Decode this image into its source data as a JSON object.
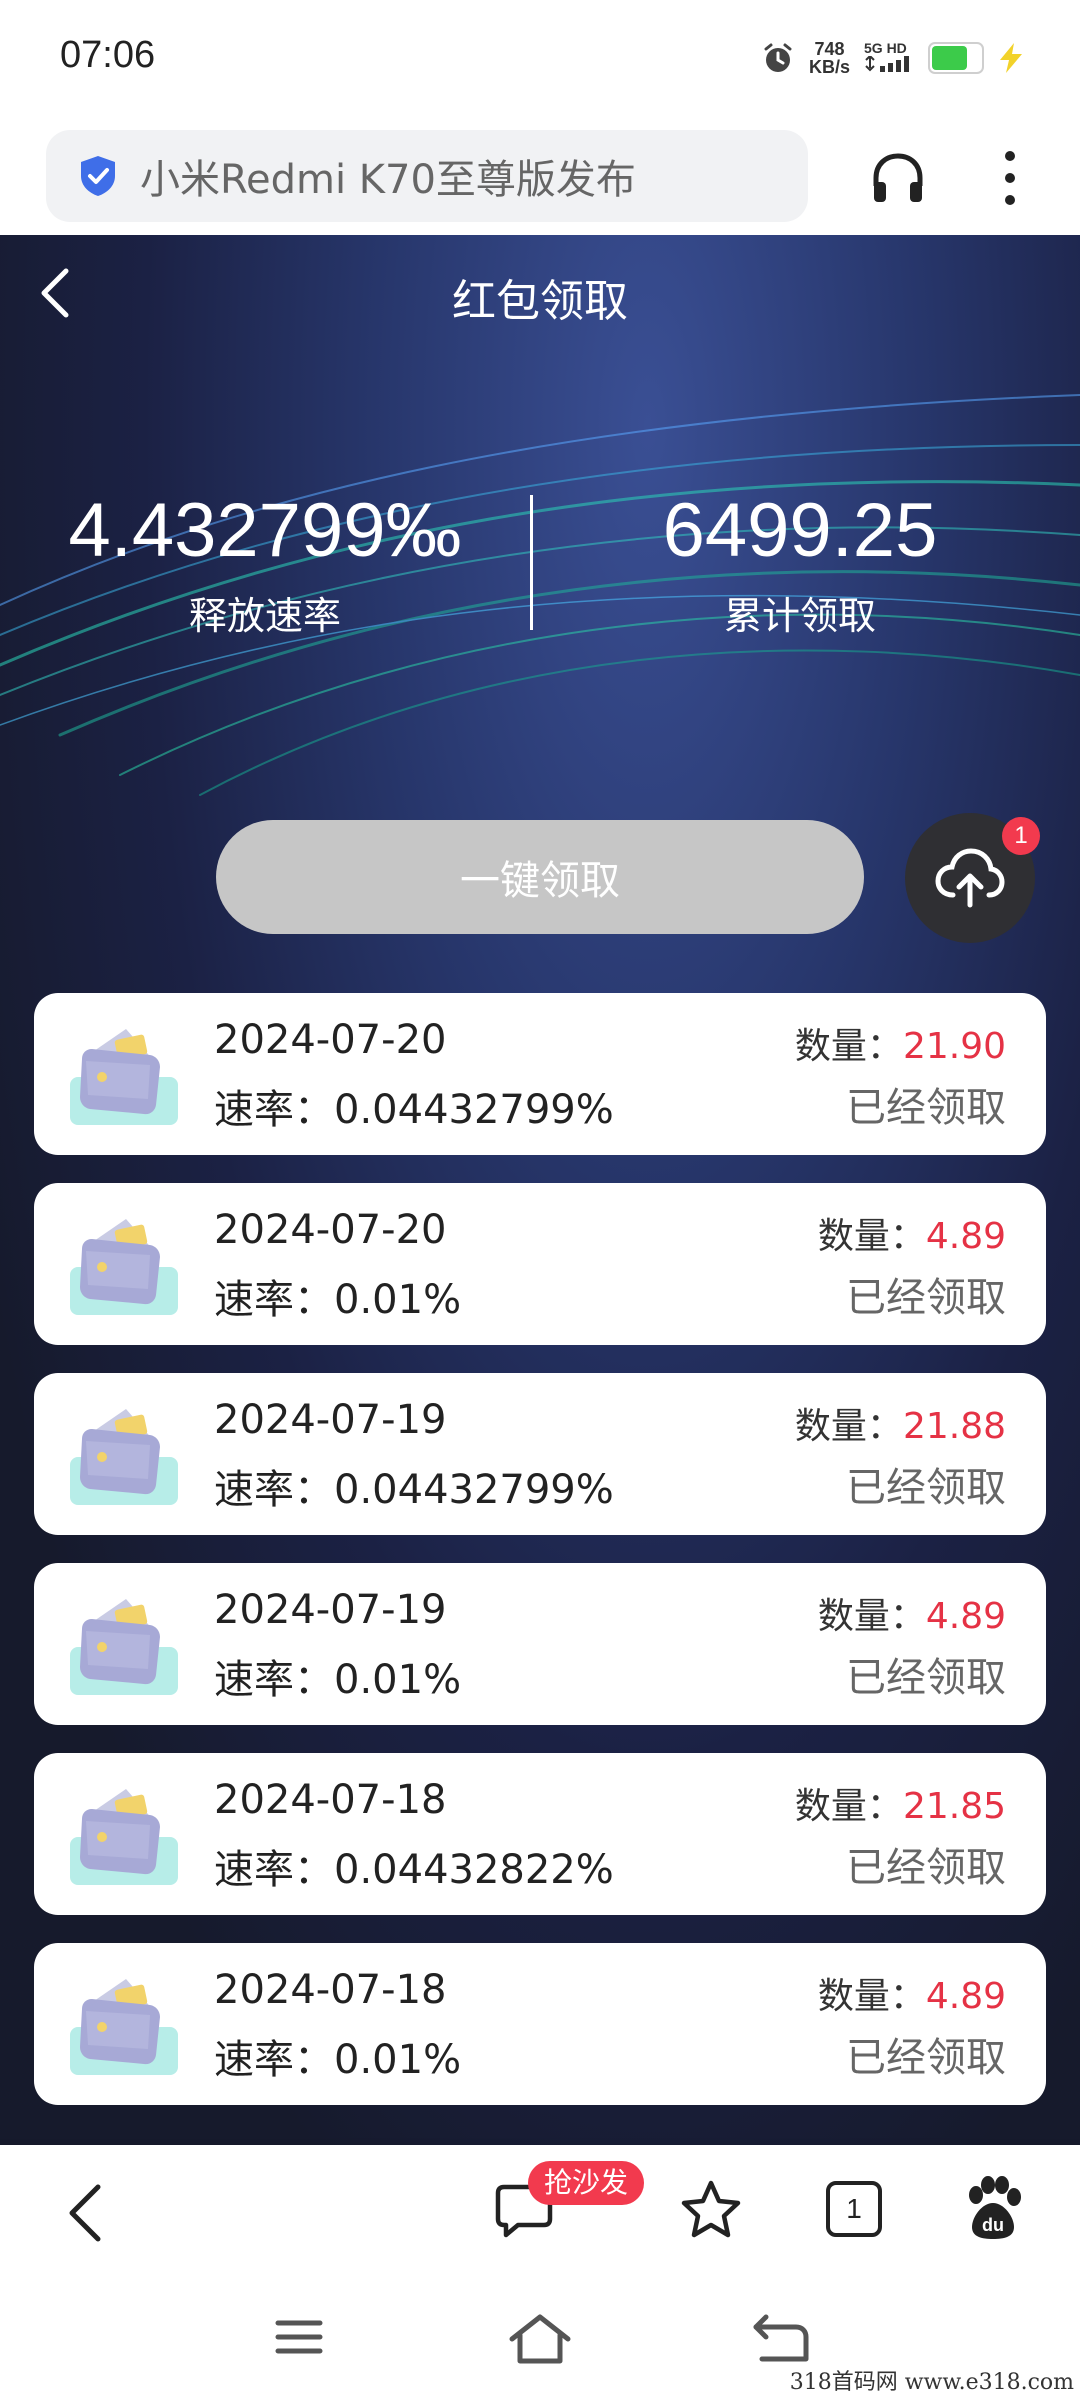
{
  "status_bar": {
    "time": "07:06",
    "speed_value": "748",
    "speed_unit": "KB/s",
    "network": "5G HD",
    "battery_level": 0.75,
    "icons": [
      "alarm-icon",
      "signal-icon",
      "battery-icon",
      "charging-bolt-icon"
    ]
  },
  "browser": {
    "url_text": "小米Redmi K70至尊版发布",
    "icons": [
      "shield-icon",
      "headphone-icon",
      "more-icon"
    ]
  },
  "page": {
    "title": "红包领取",
    "stats": [
      {
        "value": "4.432799‰",
        "label": "释放速率"
      },
      {
        "value": "6499.25",
        "label": "累计领取"
      }
    ],
    "claim_button": "一键领取",
    "upload_badge": "1"
  },
  "records": [
    {
      "date": "2024-07-20",
      "rate_label": "速率：",
      "rate": "0.04432799%",
      "amount_label": "数量：",
      "amount": "21.90",
      "status": "已经领取"
    },
    {
      "date": "2024-07-20",
      "rate_label": "速率：",
      "rate": "0.01%",
      "amount_label": "数量：",
      "amount": "4.89",
      "status": "已经领取"
    },
    {
      "date": "2024-07-19",
      "rate_label": "速率：",
      "rate": "0.04432799%",
      "amount_label": "数量：",
      "amount": "21.88",
      "status": "已经领取"
    },
    {
      "date": "2024-07-19",
      "rate_label": "速率：",
      "rate": "0.01%",
      "amount_label": "数量：",
      "amount": "4.89",
      "status": "已经领取"
    },
    {
      "date": "2024-07-18",
      "rate_label": "速率：",
      "rate": "0.04432822%",
      "amount_label": "数量：",
      "amount": "21.85",
      "status": "已经领取"
    },
    {
      "date": "2024-07-18",
      "rate_label": "速率：",
      "rate": "0.01%",
      "amount_label": "数量：",
      "amount": "4.89",
      "status": "已经领取"
    }
  ],
  "bottom_nav": {
    "hot_badge": "抢沙发",
    "tab_count": "1",
    "icons": [
      "back-icon",
      "comment-icon",
      "star-icon",
      "tabs-icon",
      "baidu-paw-icon"
    ]
  },
  "system_nav": {
    "icons": [
      "menu-icon",
      "home-icon",
      "return-icon"
    ]
  },
  "watermark": "318首码网  www.e318.com",
  "colors": {
    "amount_red": "#e53245",
    "badge_red": "#f23a4e",
    "hero_dark": "#161a2c",
    "hero_blue": "#3a4f94",
    "claim_button_gray": "#c6c6c6"
  }
}
